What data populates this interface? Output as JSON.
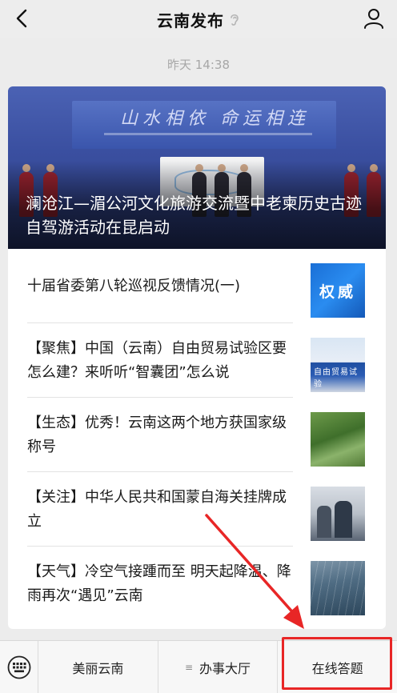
{
  "header": {
    "title": "云南发布",
    "back_icon": "chevron-left-icon",
    "profile_icon": "person-icon",
    "ear_icon": "ear-icon"
  },
  "timestamp": "昨天 14:38",
  "hero": {
    "title": "澜沧江—湄公河文化旅游交流暨中老柬历史古迹自驾游活动在昆启动",
    "banner_text": "山水相依 命运相连"
  },
  "articles": [
    {
      "title": "十届省委第八轮巡视反馈情况(一)",
      "thumb_label": "权威"
    },
    {
      "title": "【聚焦】中国（云南）自由贸易试验区要怎么建？来听听“智囊团”怎么说",
      "thumb_label": "自由贸易试验"
    },
    {
      "title": "【生态】优秀！云南这两个地方获国家级称号"
    },
    {
      "title": "【关注】中华人民共和国蒙自海关挂牌成立"
    },
    {
      "title": "【天气】冷空气接踵而至  明天起降温、降雨再次“遇见”云南"
    }
  ],
  "bottom_menu": {
    "keyboard_icon": "keyboard-icon",
    "items": [
      {
        "label": "美丽云南"
      },
      {
        "label": "办事大厅",
        "icon": "≡"
      },
      {
        "label": "在线答题"
      }
    ]
  },
  "colors": {
    "highlight": "#e82626",
    "authority_blue": "#1a6fd6"
  }
}
